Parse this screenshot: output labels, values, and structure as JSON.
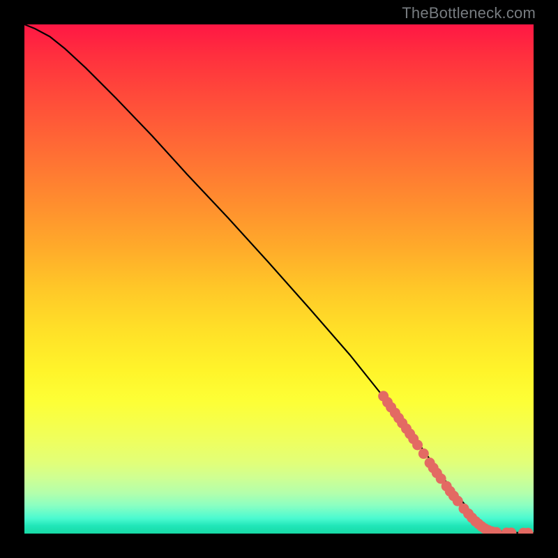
{
  "watermark": "TheBottleneck.com",
  "colors": {
    "background": "#000000",
    "curve": "#000000",
    "point_fill": "#e36a63",
    "point_stroke": "#c94b44"
  },
  "chart_data": {
    "type": "line",
    "title": "",
    "xlabel": "",
    "ylabel": "",
    "xlim": [
      0,
      100
    ],
    "ylim": [
      0,
      100
    ],
    "grid": false,
    "legend": false,
    "series": [
      {
        "name": "bottleneck-curve",
        "x": [
          0,
          2,
          5,
          8,
          12,
          18,
          25,
          32,
          40,
          48,
          56,
          64,
          70,
          75,
          79,
          82,
          85,
          87.5,
          89,
          90.5,
          92,
          94,
          96,
          98,
          100
        ],
        "y": [
          100,
          99.2,
          97.6,
          95.2,
          91.5,
          85.5,
          78.2,
          70.5,
          62,
          53.2,
          44.2,
          35,
          27.5,
          21,
          15.5,
          11.2,
          7.5,
          4.5,
          2.8,
          1.6,
          0.8,
          0.35,
          0.2,
          0.15,
          0.1
        ]
      }
    ],
    "points": [
      {
        "x": 70.5,
        "y": 27.0
      },
      {
        "x": 71.3,
        "y": 25.8
      },
      {
        "x": 72.0,
        "y": 24.8
      },
      {
        "x": 72.8,
        "y": 23.7
      },
      {
        "x": 73.5,
        "y": 22.7
      },
      {
        "x": 74.2,
        "y": 21.7
      },
      {
        "x": 75.0,
        "y": 20.6
      },
      {
        "x": 75.7,
        "y": 19.6
      },
      {
        "x": 76.4,
        "y": 18.6
      },
      {
        "x": 77.2,
        "y": 17.4
      },
      {
        "x": 78.4,
        "y": 15.7
      },
      {
        "x": 79.6,
        "y": 13.9
      },
      {
        "x": 80.3,
        "y": 12.9
      },
      {
        "x": 81.0,
        "y": 11.9
      },
      {
        "x": 81.8,
        "y": 10.8
      },
      {
        "x": 82.9,
        "y": 9.3
      },
      {
        "x": 83.6,
        "y": 8.3
      },
      {
        "x": 84.3,
        "y": 7.4
      },
      {
        "x": 85.1,
        "y": 6.4
      },
      {
        "x": 86.3,
        "y": 4.9
      },
      {
        "x": 87.2,
        "y": 3.9
      },
      {
        "x": 87.9,
        "y": 3.1
      },
      {
        "x": 88.6,
        "y": 2.4
      },
      {
        "x": 89.2,
        "y": 1.9
      },
      {
        "x": 89.8,
        "y": 1.4
      },
      {
        "x": 90.4,
        "y": 1.0
      },
      {
        "x": 91.1,
        "y": 0.65
      },
      {
        "x": 91.8,
        "y": 0.4
      },
      {
        "x": 92.7,
        "y": 0.25
      },
      {
        "x": 94.7,
        "y": 0.15
      },
      {
        "x": 95.6,
        "y": 0.15
      },
      {
        "x": 98.0,
        "y": 0.12
      },
      {
        "x": 98.9,
        "y": 0.12
      }
    ]
  }
}
